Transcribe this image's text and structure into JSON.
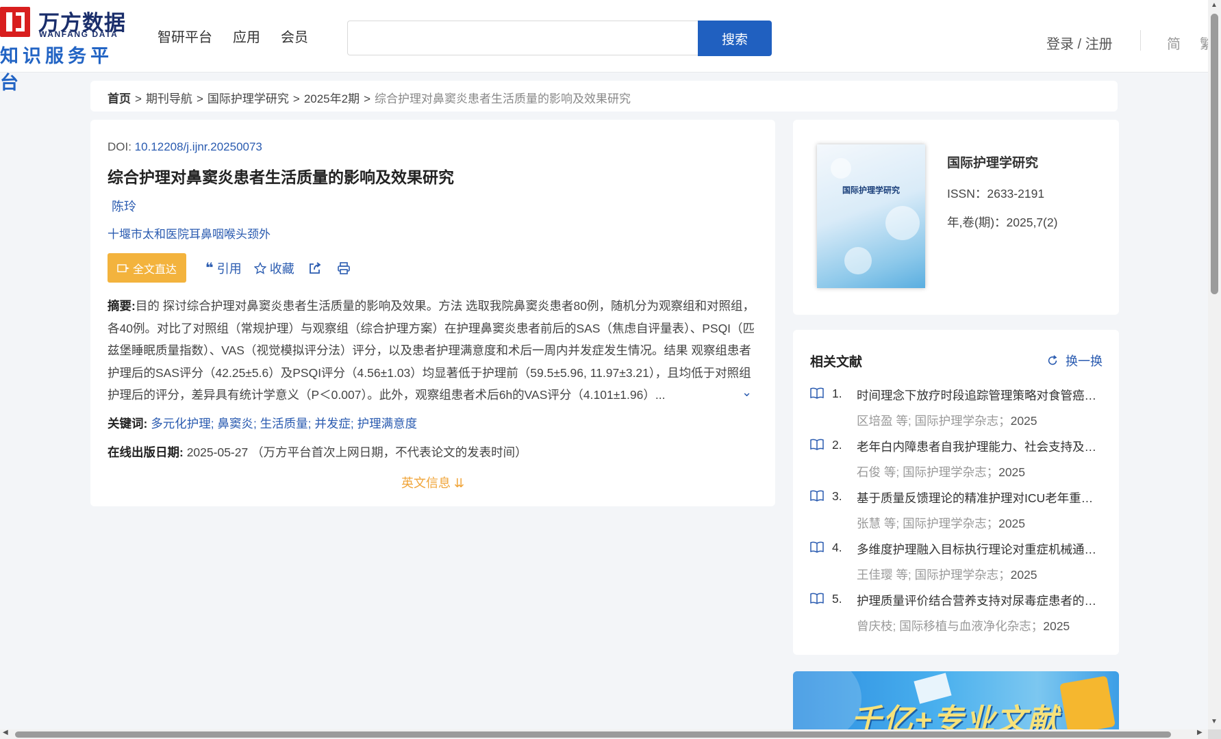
{
  "header": {
    "logo": {
      "cn": "万方数据",
      "en": "WANFANG DATA",
      "sub": "知识服务平台"
    },
    "nav": [
      "智研平台",
      "应用",
      "会员"
    ],
    "search": {
      "placeholder": "",
      "button": "搜索"
    },
    "login": "登录 / 注册",
    "lang_simplified": "简",
    "lang_traditional": "繁"
  },
  "breadcrumb": {
    "items": [
      "首页",
      "期刊导航",
      "国际护理学研究",
      "2025年2期"
    ],
    "current": "综合护理对鼻窦炎患者生活质量的影响及效果研究",
    "separator": ">"
  },
  "article": {
    "doi_label": "DOI: ",
    "doi": "10.12208/j.ijnr.20250073",
    "title": "综合护理对鼻窦炎患者生活质量的影响及效果研究",
    "author": "陈玲",
    "affiliation": "十堰市太和医院耳鼻咽喉头颈外",
    "actions": {
      "fulltext": "全文直达",
      "cite": "引用",
      "favorite": "收藏"
    },
    "abstract_label": "摘要:",
    "abstract": "目的 探讨综合护理对鼻窦炎患者生活质量的影响及效果。方法 选取我院鼻窦炎患者80例，随机分为观察组和对照组，各40例。对比了对照组（常规护理）与观察组（综合护理方案）在护理鼻窦炎患者前后的SAS（焦虑自评量表）、PSQI（匹兹堡睡眠质量指数）、VAS（视觉模拟评分法）评分，以及患者护理满意度和术后一周内并发症发生情况。结果 观察组患者护理后的SAS评分（42.25±5.6）及PSQI评分（4.56±1.03）均显著低于护理前（59.5±5.96, 11.97±3.21），且均低于对照组护理后的评分，差异具有统计学意义（P＜0.007）。此外，观察组患者术后6h的VAS评分（4.101±1.96）...",
    "keywords_label": "关键词:",
    "keywords": [
      "多元化护理",
      "鼻窦炎",
      "生活质量",
      "并发症",
      "护理满意度"
    ],
    "pubdate_label": "在线出版日期:",
    "pubdate": "2025-05-27",
    "pubdate_note": "（万方平台首次上网日期，不代表论文的发表时间）",
    "english_toggle": "英文信息"
  },
  "journal": {
    "cover_title": "国际护理学研究",
    "name": "国际护理学研究",
    "issn_label": "ISSN：",
    "issn": "2633-2191",
    "volume_label": "年,卷(期)：",
    "volume": "2025,7(2)"
  },
  "related": {
    "title": "相关文献",
    "refresh": "换一换",
    "items": [
      {
        "num": "1.",
        "title": "时间理念下放疗时段追踪管理策略对食管癌患者的影响",
        "meta": "区培盈  等;  国际护理学杂志；",
        "year": "2025"
      },
      {
        "num": "2.",
        "title": "老年白内障患者自我护理能力、社会支持及生活质量",
        "meta": "石俊  等;  国际护理学杂志；",
        "year": "2025"
      },
      {
        "num": "3.",
        "title": "基于质量反馈理论的精准护理对ICU老年重症患者",
        "meta": "张慧  等;  国际护理学杂志；",
        "year": "2025"
      },
      {
        "num": "4.",
        "title": "多维度护理融入目标执行理论对重症机械通气患者",
        "meta": "王佳璎  等;  国际护理学杂志；",
        "year": "2025"
      },
      {
        "num": "5.",
        "title": "护理质量评价结合营养支持对尿毒症患者的影响",
        "meta": "曾庆枝; 国际移植与血液净化杂志；",
        "year": "2025"
      }
    ]
  },
  "banner": {
    "text": "千亿+专业文献"
  },
  "colors": {
    "primary": "#2060c0",
    "accent": "#f3b33d",
    "link": "#2a5bb0",
    "brand_red": "#d81e1e"
  }
}
